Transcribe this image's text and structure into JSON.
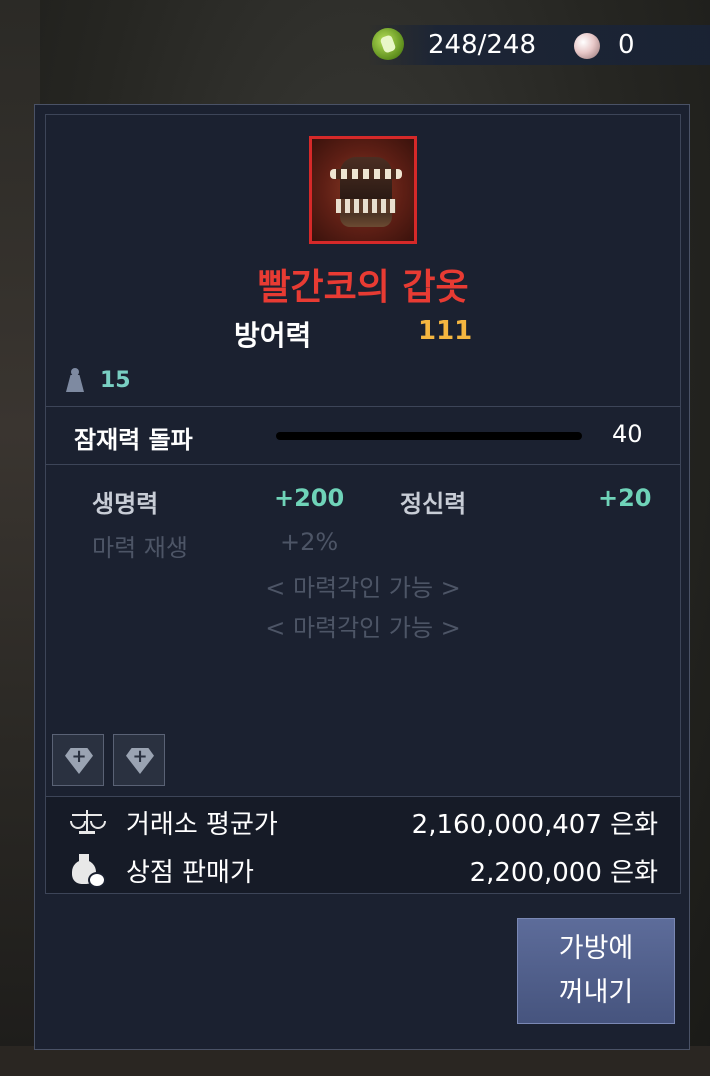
{
  "topbar": {
    "energy_icon": "energy-fist-icon",
    "energy_text": "248/248",
    "pearl_icon": "pearl-icon",
    "pearl_text": "0"
  },
  "item": {
    "icon": "red-armor-icon",
    "name": "빨간코의 갑옷",
    "name_color": "#e83b33",
    "defense_label": "방어력",
    "defense_value": "111",
    "weight_icon": "weight-icon",
    "weight_value": "15"
  },
  "potential": {
    "label": "잠재력 돌파",
    "value": "40"
  },
  "stats": {
    "hp_label": "생명력",
    "hp_value": "+200",
    "mp_label": "정신력",
    "mp_value": "+20",
    "mana_regen_label": "마력 재생",
    "mana_regen_value": "+2%"
  },
  "carving": [
    "< 마력각인 가능 >",
    "< 마력각인 가능 >"
  ],
  "sockets": [
    "gem-socket-add-icon",
    "gem-socket-add-icon"
  ],
  "prices": {
    "market_icon": "scale-icon",
    "market_label": "거래소 평균가",
    "market_value": "2,160,000,407 은화",
    "shop_icon": "money-bag-icon",
    "shop_label": "상점 판매가",
    "shop_value": "2,200,000 은화"
  },
  "button": {
    "line1": "가방에",
    "line2": "꺼내기"
  }
}
